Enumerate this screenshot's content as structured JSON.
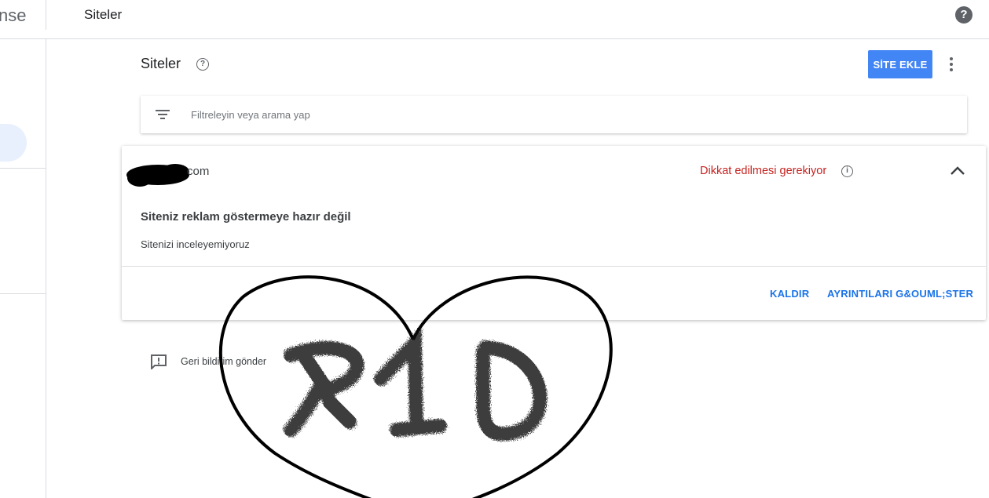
{
  "header": {
    "logo_text": "nse",
    "title": "Siteler",
    "help_icon": "help-circle-icon"
  },
  "sidebar": {
    "active_item": "sites"
  },
  "page": {
    "title": "Siteler",
    "title_help_icon": "help-outline-icon",
    "add_button_label": "SİTE EKLE",
    "more_icon": "more-vert-icon"
  },
  "search": {
    "placeholder": "Filtreleyin veya arama yap",
    "value": ""
  },
  "site_card": {
    "domain": "com",
    "status": "Dikkat edilmesi gerekiyor",
    "status_color": "#c5221f",
    "heading": "Siteniz reklam göstermeye hazır değil",
    "subtext": "Sitenizi inceleyemiyoruz",
    "remove_label": "KALDIR",
    "details_label": "AYRINTILARI G&OUML;STER"
  },
  "feedback": {
    "label": "Geri bildirim gönder"
  },
  "overlay": {
    "text": "R1D",
    "shape": "heart-outline"
  },
  "colors": {
    "accent": "#4285f4",
    "link": "#1a73e8",
    "warning": "#c5221f"
  }
}
